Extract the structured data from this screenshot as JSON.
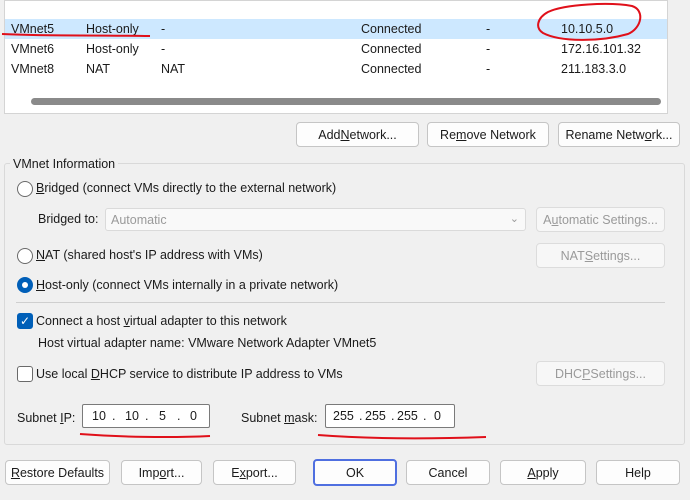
{
  "networks": [
    {
      "name": "VMnet5",
      "type": "Host-only",
      "external": "-",
      "host_connection": "Connected",
      "dhcp": "-",
      "subnet": "10.10.5.0"
    },
    {
      "name": "VMnet6",
      "type": "Host-only",
      "external": "-",
      "host_connection": "Connected",
      "dhcp": "-",
      "subnet": "172.16.101.32"
    },
    {
      "name": "VMnet8",
      "type": "NAT",
      "external": "NAT",
      "host_connection": "Connected",
      "dhcp": "-",
      "subnet": "211.183.3.0"
    }
  ],
  "net_buttons": {
    "add": {
      "pre": "Add ",
      "u": "N",
      "post": "etwork..."
    },
    "remove": {
      "pre": "Re",
      "u": "m",
      "post": "ove Network"
    },
    "rename": {
      "pre": "Rename Netw",
      "u": "o",
      "post": "rk..."
    }
  },
  "vmnet_info": {
    "group_label": "VMnet Information",
    "bridged": {
      "u": "B",
      "rest": "ridged (connect VMs directly to the external network)",
      "checked": false
    },
    "bridged_to": {
      "label": "Bridged to:",
      "value": "Automatic"
    },
    "auto_settings": {
      "pre": "A",
      "u": "u",
      "post": "tomatic Settings..."
    },
    "nat": {
      "u": "N",
      "rest": "AT (shared host's IP address with VMs)",
      "checked": false
    },
    "nat_settings": {
      "pre": "NAT ",
      "u": "S",
      "post": "ettings..."
    },
    "hostonly": {
      "u": "H",
      "rest": "ost-only (connect VMs internally in a private network)",
      "checked": true
    },
    "connect_adapter": {
      "pre": "Connect a host ",
      "u": "v",
      "post": "irtual adapter to this network",
      "checked": true
    },
    "adapter_name": "Host virtual adapter name: VMware Network Adapter VMnet5",
    "use_dhcp": {
      "pre": "Use local ",
      "u": "D",
      "post": "HCP service to distribute IP address to VMs",
      "checked": false
    },
    "dhcp_settings": {
      "pre": "DHC",
      "u": "P",
      "post": " Settings..."
    },
    "subnet_ip": {
      "pre": "Subnet ",
      "u": "I",
      "post": "P:",
      "octets": [
        "10",
        "10",
        "5",
        "0"
      ]
    },
    "subnet_mask": {
      "pre": "Subnet ",
      "u": "m",
      "post": "ask:",
      "octets": [
        "255",
        "255",
        "255",
        "0"
      ]
    }
  },
  "footer": {
    "restore": {
      "u": "R",
      "post": "estore Defaults"
    },
    "import": {
      "pre": "Imp",
      "u": "o",
      "post": "rt..."
    },
    "export": {
      "pre": "E",
      "u": "x",
      "post": "port..."
    },
    "ok": "OK",
    "cancel": "Cancel",
    "apply": {
      "u": "A",
      "post": "pply"
    },
    "help": "Help"
  },
  "colors": {
    "accent": "#005fb8",
    "selection": "#cde8ff",
    "annotation": "#e0101a"
  }
}
